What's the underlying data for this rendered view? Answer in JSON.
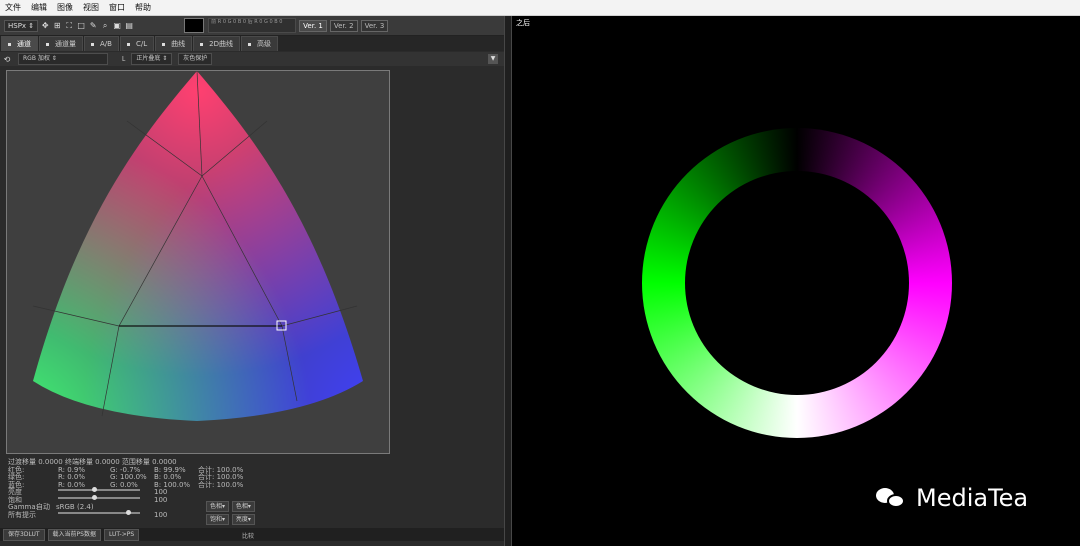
{
  "menu": [
    "文件",
    "编辑",
    "图像",
    "视图",
    "窗口",
    "帮助"
  ],
  "toolbar": {
    "mode": "HSPx ⇕",
    "color_values": "前  R 0  G 0  B 0  后  R 0  G 0  B 0",
    "versions": [
      "Ver. 1",
      "Ver. 2",
      "Ver. 3"
    ]
  },
  "tabs": [
    "通道",
    "通道量",
    "A/B",
    "C/L",
    "曲线",
    "2D曲线",
    "高级"
  ],
  "subbar": {
    "rgb_sel": "RGB 加权 ⇕",
    "opt_sel": "正片叠底 ⇕",
    "protect": "灰色保护"
  },
  "stats": {
    "line1": "过渡移量  0.0000   终端移量  0.0000   范围移量  0.0000",
    "rows": [
      {
        "label": "红色:",
        "r": "R: 0.9%",
        "g": "G: -0.7%",
        "b": "B: 99.9%",
        "sum": "合计: 100.0%"
      },
      {
        "label": "绿色:",
        "r": "R: 0.0%",
        "g": "G: 100.0%",
        "b": "B: 0.0%",
        "sum": "合计: 100.0%"
      },
      {
        "label": "蓝色:",
        "r": "R: 0.0%",
        "g": "G: 0.0%",
        "b": "B: 100.0%",
        "sum": "合计: 100.0%"
      }
    ],
    "s1_label": "亮度",
    "s1_val": "100",
    "s2_label": "饱和",
    "s2_val": "100",
    "gamma_label": "Gamma:",
    "gamma_auto": "自动",
    "gamma_val": "sRGB (2.4)",
    "s3_label": "所有提示",
    "s3_val": "100"
  },
  "right_buttons": [
    "色相▾",
    "色相▾",
    "饱和▾",
    "亮度▾"
  ],
  "bottom": {
    "buttons": [
      "保存3DLUT",
      "载入当前PS数据",
      "LUT->PS"
    ],
    "label": "比较"
  },
  "right_panel": {
    "title": "之后"
  },
  "watermark": "MediaTea"
}
